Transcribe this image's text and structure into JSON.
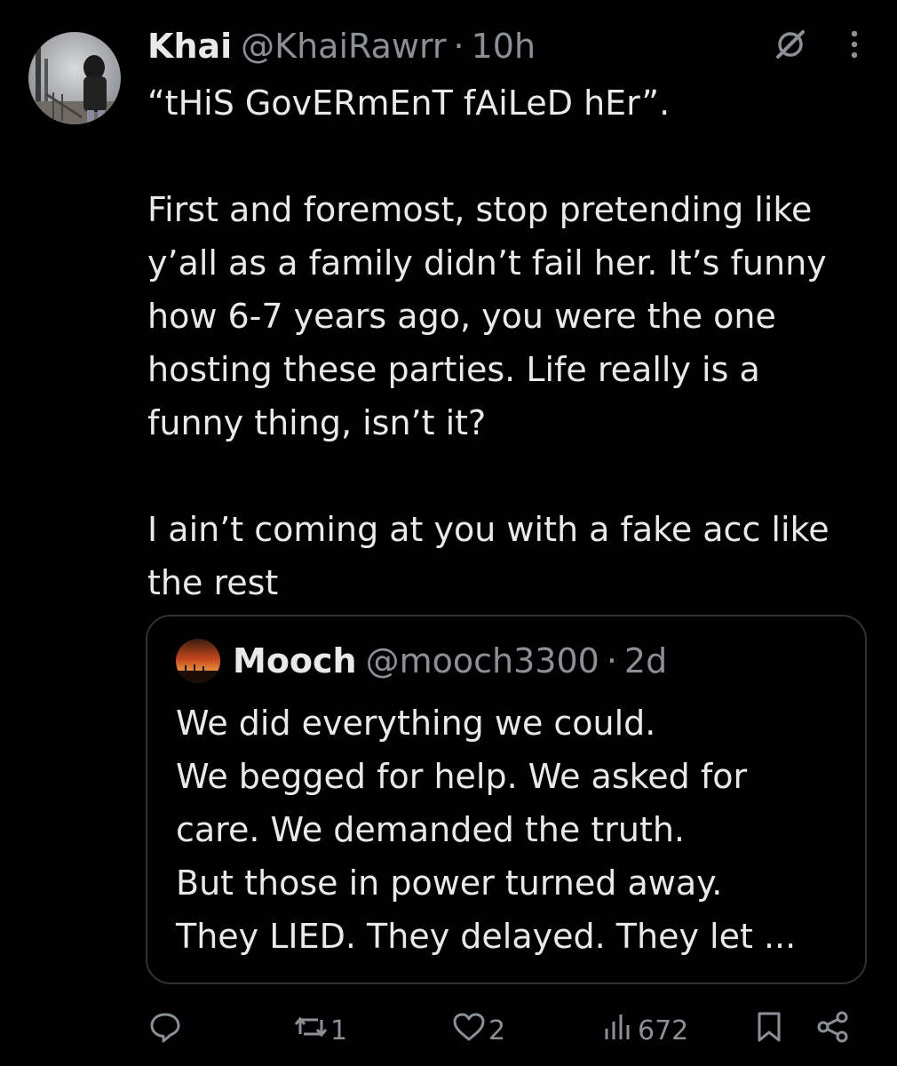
{
  "tweet": {
    "author_name": "Khai",
    "author_handle": "@KhaiRawrr",
    "separator": "·",
    "time": "10h",
    "text": "“tHiS GovERmEnT fAiLeD hEr”.\n\nFirst and foremost, stop pretending like\ny’all as a family didn’t fail her. It’s funny\nhow 6-7 years ago, you were the one\nhosting these parties. Life really is a\nfunny thing, isn’t it?\n\nI ain’t coming at you with a fake acc like\nthe rest"
  },
  "quoted_tweet": {
    "author_name": "Mooch",
    "author_handle": "@mooch3300",
    "separator": "·",
    "time": "2d",
    "text": "We did everything we could.\nWe begged for help. We asked for\ncare. We demanded the truth.\nBut those in power turned away.\nThey LIED. They delayed. They let ..."
  },
  "actions": {
    "replies": "",
    "retweets": "1",
    "likes": "2",
    "views": "672"
  },
  "icons": {
    "top_right": [
      "grok-icon",
      "more-vertical-icon"
    ],
    "action_bar": [
      "reply-icon",
      "retweet-icon",
      "like-icon",
      "views-icon",
      "bookmark-icon",
      "share-icon"
    ]
  },
  "colors": {
    "background": "#000000",
    "text_primary": "#e7e9ea",
    "text_secondary": "#8b9096",
    "border": "#2f3336"
  }
}
